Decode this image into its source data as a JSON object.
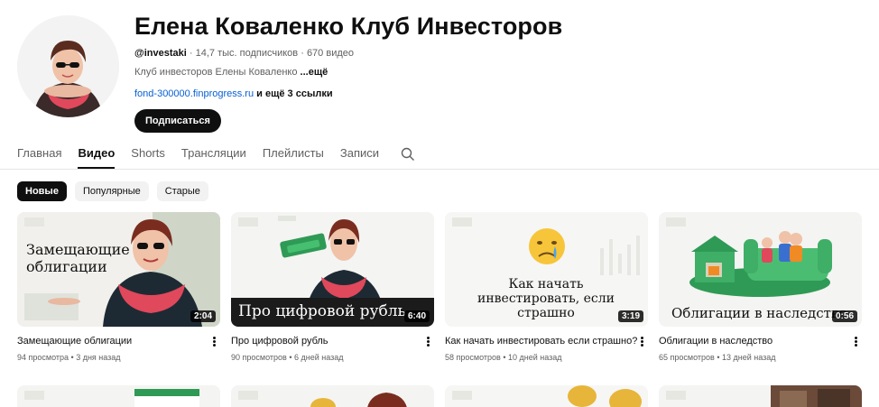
{
  "channel": {
    "title": "Елена Коваленко Клуб Инвесторов",
    "handle": "@investaki",
    "subscribers": "14,7 тыс. подписчиков",
    "video_count": "670 видео",
    "description": "Клуб инвесторов Елены Коваленко",
    "more_label": "...ещё",
    "link": "fond-300000.finprogress.ru",
    "more_links": "и ещё 3 ссылки",
    "subscribe_label": "Подписаться"
  },
  "tabs": [
    {
      "label": "Главная"
    },
    {
      "label": "Видео"
    },
    {
      "label": "Shorts"
    },
    {
      "label": "Трансляции"
    },
    {
      "label": "Плейлисты"
    },
    {
      "label": "Записи"
    }
  ],
  "chips": [
    {
      "label": "Новые"
    },
    {
      "label": "Популярные"
    },
    {
      "label": "Старые"
    }
  ],
  "videos": [
    {
      "title": "Замещающие облигации",
      "views": "94 просмотра",
      "date": "3 дня назад",
      "duration": "2:04",
      "thumb_text": "Замещающие облигации"
    },
    {
      "title": "Про цифровой рубль",
      "views": "90 просмотров",
      "date": "6 дней назад",
      "duration": "6:40",
      "thumb_text": "Про цифровой рубль"
    },
    {
      "title": "Как начать инвестировать если страшно?",
      "views": "58 просмотров",
      "date": "10 дней назад",
      "duration": "3:19",
      "thumb_text": "Как начать инвестировать, если страшно"
    },
    {
      "title": "Облигации в наследство",
      "views": "65 просмотров",
      "date": "13 дней назад",
      "duration": "0:56",
      "thumb_text": "Облигации в наследство"
    }
  ],
  "colors": {
    "accent_link": "#065fd4",
    "green": "#2e8b4e",
    "red_scarf": "#e0485c"
  }
}
